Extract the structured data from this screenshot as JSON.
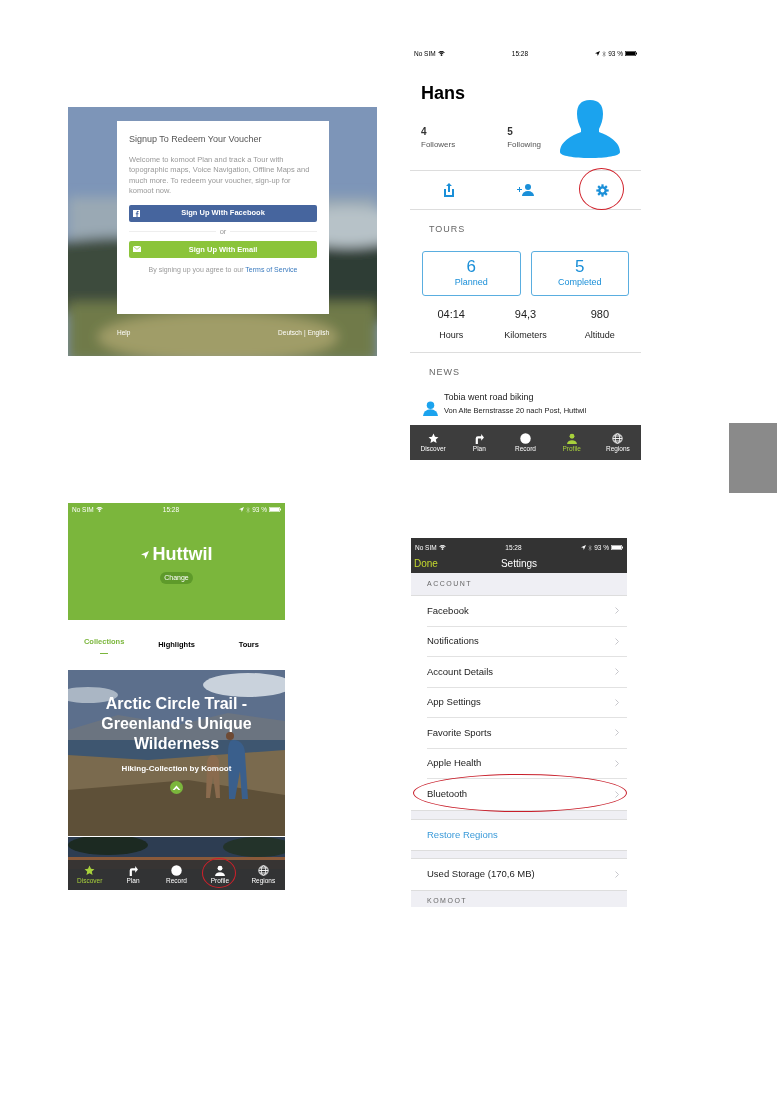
{
  "signup_screen": {
    "title": "Signup To Redeem Your Voucher",
    "body": "Welcome to komoot Plan and track a Tour with topographic maps, Voice Navigation, Offline Maps and much more. To redeem your voucher, sign-up for komoot now.",
    "buttons": [
      {
        "kind": "facebook",
        "label": "Sign Up With Facebook"
      },
      {
        "kind": "separator",
        "label": "or"
      },
      {
        "kind": "email",
        "label": "Sign Up With Email"
      }
    ],
    "terms_text": "By signing up you agree to our",
    "terms_link": "Terms of Service",
    "help": "Help",
    "languages": [
      "Deutsch",
      "English"
    ],
    "language_separator": "|"
  },
  "profile_screen": {
    "status_bar": {
      "carrier": "No SIM",
      "time": "15:28",
      "battery": "93 %"
    },
    "name": "Hans",
    "stats": [
      {
        "count": "4",
        "label": "Followers"
      },
      {
        "count": "5",
        "label": "Following"
      }
    ],
    "actions": [
      {
        "kind": "share",
        "annotated": false
      },
      {
        "kind": "add-friend",
        "annotated": false
      },
      {
        "kind": "settings",
        "annotated": true
      }
    ],
    "tours_heading": "TOURS",
    "tour_counts": [
      {
        "value": "6",
        "label": "Planned"
      },
      {
        "value": "5",
        "label": "Completed"
      }
    ],
    "totals": [
      {
        "value": "04:14",
        "label": "Hours"
      },
      {
        "value": "94,3",
        "label": "Kilometers"
      },
      {
        "value": "980",
        "label": "Altitude"
      }
    ],
    "news_heading": "NEWS",
    "news": [
      {
        "title": "Tobia went road biking",
        "subtitle": "Von Alte Bernstrasse 20 nach Post, Huttwil"
      }
    ],
    "tab_bar": [
      {
        "kind": "discover",
        "label": "Discover",
        "selected": false,
        "annotated": false
      },
      {
        "kind": "plan",
        "label": "Plan",
        "selected": false,
        "annotated": false
      },
      {
        "kind": "record",
        "label": "Record",
        "selected": false,
        "annotated": false
      },
      {
        "kind": "profile",
        "label": "Profile",
        "selected": true,
        "annotated": false
      },
      {
        "kind": "regions",
        "label": "Regions",
        "selected": false,
        "annotated": false
      }
    ]
  },
  "discover_screen": {
    "status_bar": {
      "carrier": "No SIM",
      "time": "15:28",
      "battery": "93 %"
    },
    "location": "Huttwil",
    "change_button": "Change",
    "tabs": [
      {
        "label": "Collections",
        "selected": true
      },
      {
        "label": "Highlights",
        "selected": false
      },
      {
        "label": "Tours",
        "selected": false
      }
    ],
    "collection": {
      "title": "Arctic Circle Trail - Greenland's Unique Wilderness",
      "subtitle": "Hiking-Collection by Komoot"
    },
    "tab_bar": [
      {
        "kind": "discover",
        "label": "Discover",
        "selected": true,
        "annotated": false
      },
      {
        "kind": "plan",
        "label": "Plan",
        "selected": false,
        "annotated": false
      },
      {
        "kind": "record",
        "label": "Record",
        "selected": false,
        "annotated": false
      },
      {
        "kind": "profile",
        "label": "Profile",
        "selected": false,
        "annotated": true
      },
      {
        "kind": "regions",
        "label": "Regions",
        "selected": false,
        "annotated": false
      }
    ]
  },
  "settings_screen": {
    "status_bar": {
      "carrier": "No SIM",
      "time": "15:28",
      "battery": "93 %"
    },
    "done": "Done",
    "title": "Settings",
    "sections": [
      {
        "heading": "ACCOUNT",
        "rows": [
          {
            "label": "Facebook",
            "kind": "nav",
            "annotated": false
          },
          {
            "label": "Notifications",
            "kind": "nav",
            "annotated": false
          },
          {
            "label": "Account Details",
            "kind": "nav",
            "annotated": false
          },
          {
            "label": "App Settings",
            "kind": "nav",
            "annotated": false
          },
          {
            "label": "Favorite Sports",
            "kind": "nav",
            "annotated": false
          },
          {
            "label": "Apple Health",
            "kind": "nav",
            "annotated": false
          },
          {
            "label": "Bluetooth",
            "kind": "nav",
            "annotated": true
          }
        ]
      },
      {
        "rows": [
          {
            "label": "Restore Regions",
            "kind": "link",
            "annotated": false
          }
        ]
      },
      {
        "rows": [
          {
            "label": "Used Storage (170,6 MB)",
            "kind": "nav",
            "annotated": false
          }
        ]
      },
      {
        "heading": "KOMOOT"
      }
    ]
  }
}
